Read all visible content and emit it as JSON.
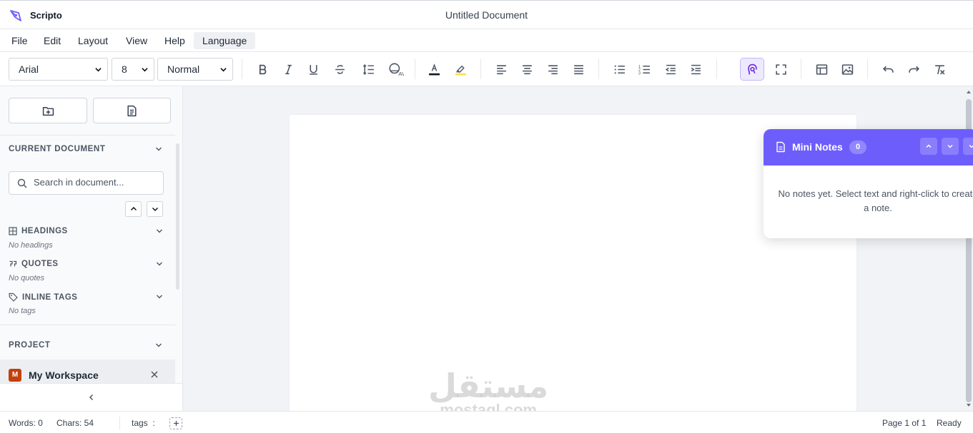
{
  "app": {
    "name": "Scripto",
    "document_title": "Untitled Document",
    "accent": "#6d5efc"
  },
  "menu": [
    "File",
    "Edit",
    "Layout",
    "View",
    "Help",
    "Language"
  ],
  "toolbar": {
    "font_family": "Arial",
    "font_size": "8",
    "paragraph_style": "Normal",
    "buttons": [
      "bold-icon",
      "italic-icon",
      "underline-icon",
      "strikethrough-icon",
      "line-height-icon",
      "character-spacing-icon",
      "text-color-icon",
      "highlight-icon",
      "align-left-icon",
      "align-center-icon",
      "align-right-icon",
      "justify-icon",
      "bullet-list-icon",
      "numbered-list-icon",
      "outdent-icon",
      "indent-icon",
      "focus-mode-icon",
      "fullscreen-icon",
      "insert-table-icon",
      "insert-image-icon",
      "undo-icon",
      "redo-icon",
      "clear-formatting-icon"
    ],
    "text_color": "#111827",
    "highlight_color": "#fde047"
  },
  "sidebar": {
    "current_document_heading": "CURRENT DOCUMENT",
    "search_placeholder": "Search in document...",
    "headings_label": "HEADINGS",
    "headings_empty": "No headings",
    "quotes_label": "QUOTES",
    "quotes_empty": "No quotes",
    "tags_label": "INLINE TAGS",
    "tags_empty": "No tags",
    "project_heading": "PROJECT",
    "workspace_badge": "M",
    "workspace_name": "My Workspace"
  },
  "mini_notes": {
    "title": "Mini Notes",
    "count": "0",
    "empty_message": "No notes yet. Select text and right-click to create a note."
  },
  "watermark": {
    "arabic": "مستقل",
    "latin": "mostaql.com"
  },
  "status": {
    "words": "Words: 0",
    "chars": "Chars: 54",
    "tags_label": "tags  :",
    "page": "Page 1 of 1",
    "state": "Ready"
  }
}
